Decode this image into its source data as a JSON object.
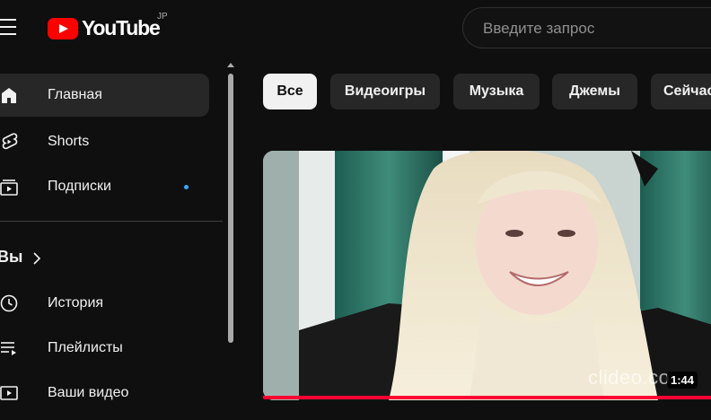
{
  "header": {
    "logo_text": "YouTube",
    "region": "JP",
    "search_placeholder": "Введите запрос"
  },
  "sidebar": {
    "items": [
      {
        "label": "Главная",
        "icon": "home-icon",
        "active": true
      },
      {
        "label": "Shorts",
        "icon": "shorts-icon"
      },
      {
        "label": "Подписки",
        "icon": "subscriptions-icon",
        "badge": "new-content-dot"
      }
    ],
    "you_section": {
      "heading": "Вы",
      "items": [
        {
          "label": "История",
          "icon": "history-icon"
        },
        {
          "label": "Плейлисты",
          "icon": "playlists-icon"
        },
        {
          "label": "Ваши видео",
          "icon": "your-videos-icon"
        }
      ]
    }
  },
  "chips": [
    "Все",
    "Видеоигры",
    "Музыка",
    "Джемы",
    "Сейчас"
  ],
  "video": {
    "duration": "1:44",
    "watermark": "clideo.co",
    "progress_fraction": 1.0
  },
  "colors": {
    "background": "#0f0f0f",
    "accent_red": "#ff0000",
    "chip_bg": "#272727",
    "active_chip_bg": "#f1f1f1",
    "notification_dot": "#3ea6ff"
  }
}
